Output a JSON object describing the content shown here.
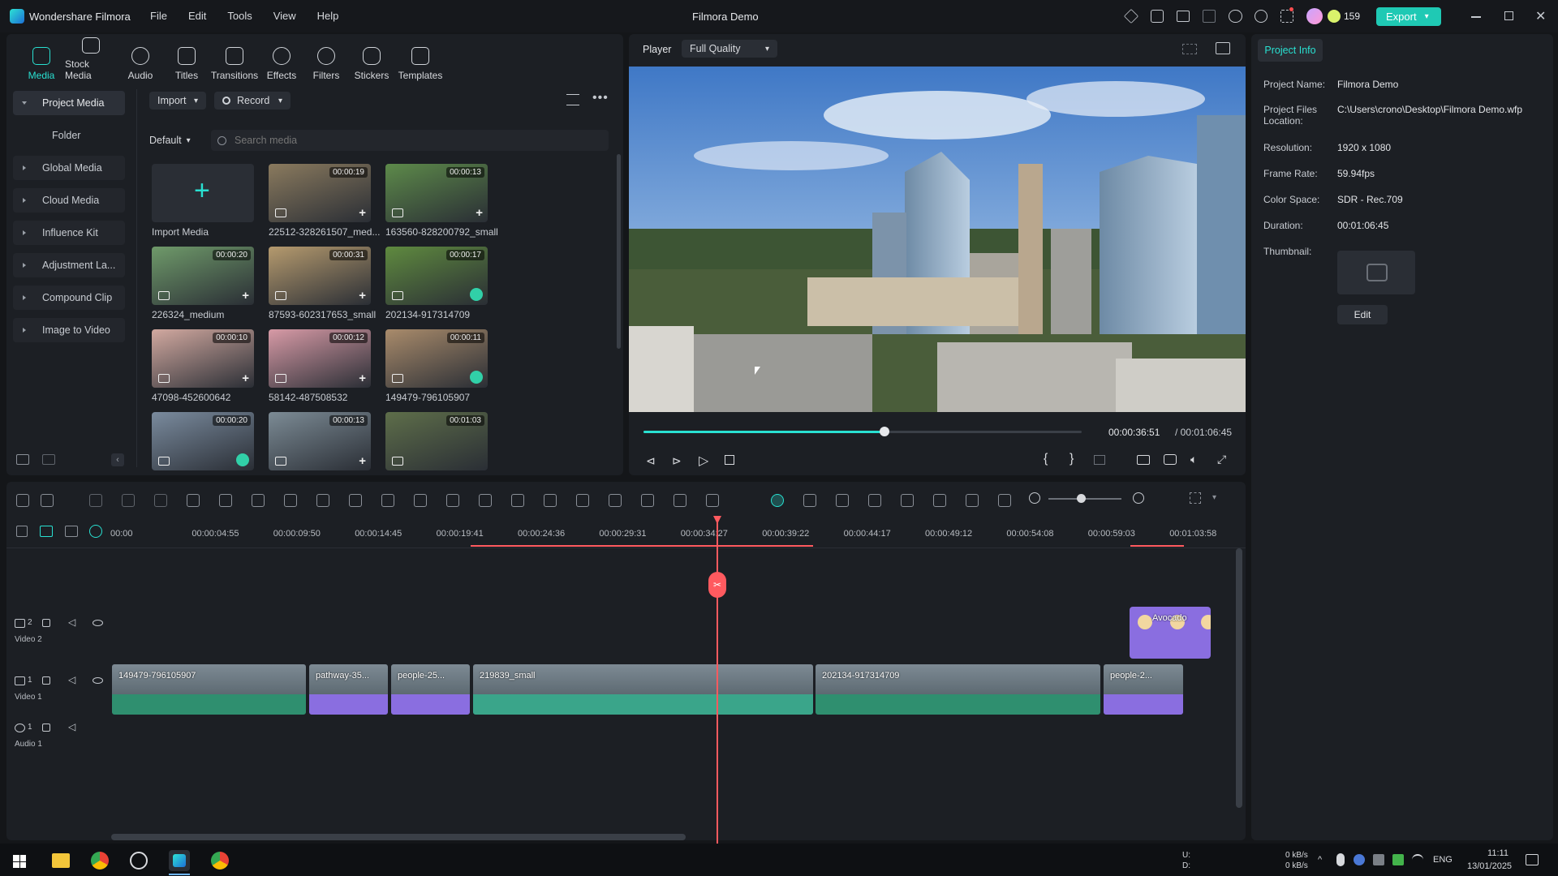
{
  "app": {
    "name": "Wondershare Filmora",
    "title": "Filmora Demo",
    "credits": "159",
    "export_label": "Export"
  },
  "menu": [
    "File",
    "Edit",
    "Tools",
    "View",
    "Help"
  ],
  "toolbar_tabs": [
    "Media",
    "Stock Media",
    "Audio",
    "Titles",
    "Transitions",
    "Effects",
    "Filters",
    "Stickers",
    "Templates"
  ],
  "sidebar": [
    "Project Media",
    "Folder",
    "Global Media",
    "Cloud Media",
    "Influence Kit",
    "Adjustment La...",
    "Compound Clip",
    "Image to Video"
  ],
  "media": {
    "import_label": "Import",
    "record_label": "Record",
    "sort_label": "Default",
    "search_placeholder": "Search media",
    "import_media_label": "Import Media",
    "items": [
      {
        "name": "22512-328261507_med...",
        "duration": "00:00:19",
        "color": "#8a7a5e"
      },
      {
        "name": "163560-828200792_small",
        "duration": "00:00:13",
        "color": "#5d8a4a"
      },
      {
        "name": "226324_medium",
        "duration": "00:00:20",
        "color": "#6f9a6a"
      },
      {
        "name": "87593-602317653_small",
        "duration": "00:00:31",
        "color": "#b59a6e"
      },
      {
        "name": "202134-917314709",
        "duration": "00:00:17",
        "color": "#5f8a3f"
      },
      {
        "name": "47098-452600642",
        "duration": "00:00:10",
        "color": "#d2a9a0"
      },
      {
        "name": "58142-487508532",
        "duration": "00:00:12",
        "color": "#d79aa6"
      },
      {
        "name": "149479-796105907",
        "duration": "00:00:11",
        "color": "#a98b6b"
      },
      {
        "name": "",
        "duration": "00:00:20",
        "color": "#7a8b9e"
      },
      {
        "name": "",
        "duration": "00:00:13",
        "color": "#7c8b95"
      },
      {
        "name": "",
        "duration": "00:01:03",
        "color": "#5e6e4a"
      }
    ]
  },
  "player": {
    "label": "Player",
    "quality": "Full Quality",
    "current_time": "00:00:36:51",
    "total_time": "/ 00:01:06:45",
    "progress": 0.55
  },
  "project_info": {
    "tab": "Project Info",
    "rows": [
      {
        "key": "Project Name:",
        "value": "Filmora Demo"
      },
      {
        "key": "Project Files Location:",
        "value": "C:\\Users\\crono\\Desktop\\Filmora Demo.wfp"
      },
      {
        "key": "Resolution:",
        "value": "1920 x 1080"
      },
      {
        "key": "Frame Rate:",
        "value": "59.94fps"
      },
      {
        "key": "Color Space:",
        "value": "SDR - Rec.709"
      },
      {
        "key": "Duration:",
        "value": "00:01:06:45"
      },
      {
        "key": "Thumbnail:",
        "value": ""
      }
    ],
    "edit_label": "Edit"
  },
  "timeline": {
    "ruler": [
      "00:00",
      "00:00:04:55",
      "00:00:09:50",
      "00:00:14:45",
      "00:00:19:41",
      "00:00:24:36",
      "00:00:29:31",
      "00:00:34:27",
      "00:00:39:22",
      "00:00:44:17",
      "00:00:49:12",
      "00:00:54:08",
      "00:00:59:03",
      "00:01:03:58"
    ],
    "tracks": [
      {
        "num": "2",
        "name": "Video 2"
      },
      {
        "num": "1",
        "name": "Video 1"
      },
      {
        "num": "1",
        "name": "Audio 1"
      }
    ],
    "video2_clips": [
      {
        "label": "Avocado",
        "color": "#8a6ee0"
      }
    ],
    "video1_clips": [
      {
        "label": "149479-796105907",
        "color": "#2f8f6f"
      },
      {
        "label": "pathway-35...",
        "color": "#8a6ee0"
      },
      {
        "label": "people-25...",
        "color": "#8a6ee0"
      },
      {
        "label": "219839_small",
        "color": "#3aa58a"
      },
      {
        "label": "202134-917314709",
        "color": "#2f8f6f"
      },
      {
        "label": "people-2...",
        "color": "#8a6ee0"
      }
    ]
  },
  "taskbar": {
    "net_up": "0 kB/s",
    "net_down": "0 kB/s",
    "lang": "ENG",
    "time": "11:11",
    "date": "13/01/2025",
    "u": "U:",
    "d": "D:"
  }
}
